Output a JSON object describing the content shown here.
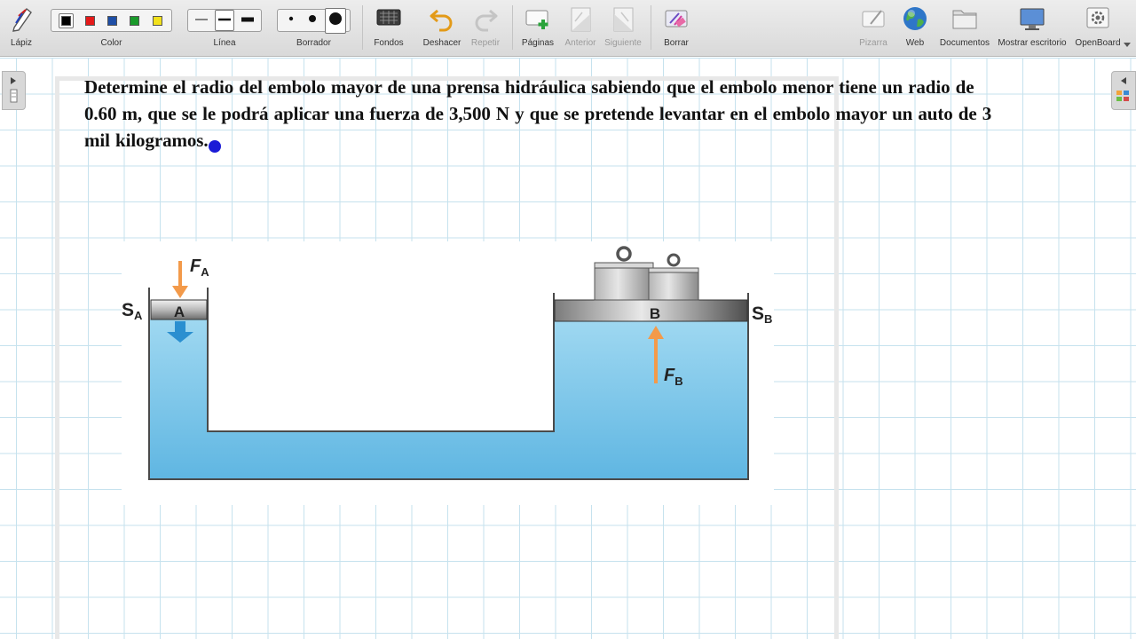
{
  "toolbar": {
    "pen": {
      "label": "Lápiz",
      "icon": "pen-icon"
    },
    "color": {
      "label": "Color",
      "colors": [
        "#000000",
        "#e51a1a",
        "#1f4fa6",
        "#1a9a2b",
        "#f2e11c"
      ]
    },
    "line": {
      "label": "Línea"
    },
    "eraser": {
      "label": "Borrador"
    },
    "backgrounds": {
      "label": "Fondos",
      "icon": "backgrounds-icon"
    },
    "undo": {
      "label": "Deshacer",
      "icon": "undo-icon"
    },
    "redo": {
      "label": "Repetir",
      "icon": "redo-icon"
    },
    "pages": {
      "label": "Páginas",
      "icon": "add-page-icon"
    },
    "previous": {
      "label": "Anterior",
      "icon": "previous-page-icon"
    },
    "next": {
      "label": "Siguiente",
      "icon": "next-page-icon"
    },
    "erase": {
      "label": "Borrar",
      "icon": "erase-icon"
    },
    "board": {
      "label": "Pizarra",
      "icon": "board-icon"
    },
    "web": {
      "label": "Web",
      "icon": "globe-icon"
    },
    "documents": {
      "label": "Documentos",
      "icon": "folder-icon"
    },
    "desktop": {
      "label": "Mostrar escritorio",
      "icon": "desktop-icon"
    },
    "openboard": {
      "label": "OpenBoard",
      "icon": "settings-icon"
    }
  },
  "problem": {
    "text": "Determine el radio del embolo mayor de una prensa hidráulica sabiendo que el embolo menor tiene un radio de 0.60 m, que se le podrá aplicar una fuerza de 3,500 N y que se pretende levantar en el embolo mayor un auto de 3 mil kilogramos."
  },
  "figure": {
    "small_piston": "A",
    "large_piston": "B",
    "force_small": "F",
    "force_small_sub": "A",
    "force_large": "F",
    "force_large_sub": "B",
    "area_small": "S",
    "area_small_sub": "A",
    "area_large": "S",
    "area_large_sub": "B",
    "fluid_color": "#7fcaea",
    "arrow_color": "#f39a4a"
  }
}
